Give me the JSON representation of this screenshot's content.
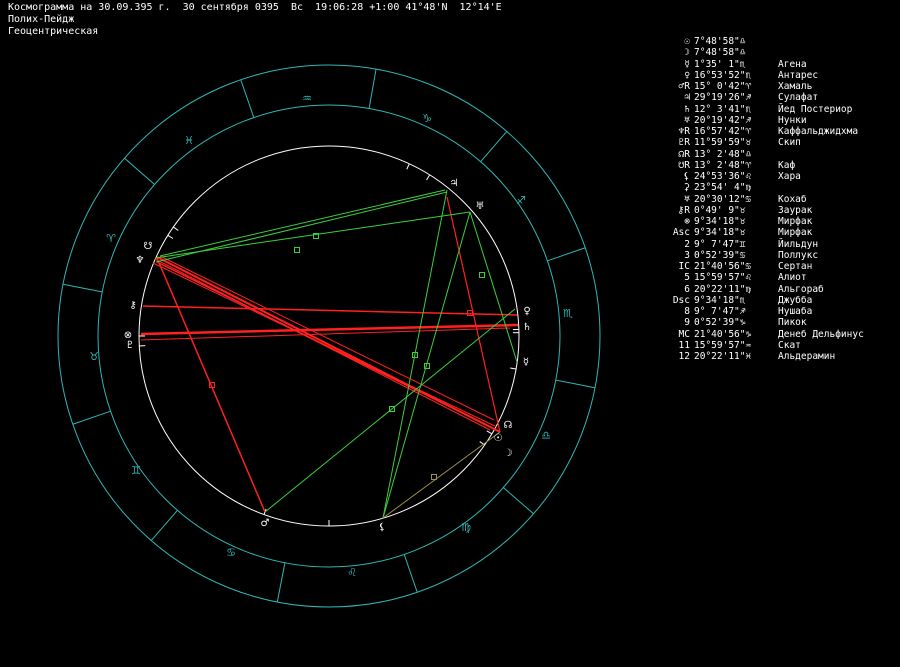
{
  "header": {
    "line1": "Космограмма на 30.09.395 г.  30 сентября 0395  Вс  19:06:28 +1:00 41°48'N  12°14'E",
    "line2": "Полих-Пейдж",
    "line3": "Геоцентрическая"
  },
  "colors": {
    "background": "#000000",
    "ring": "#2fb6b6",
    "wheel_line": "#ffffff",
    "aspect_red": "#ff2020",
    "aspect_green": "#3ccf3c",
    "aspect_olive": "#9a8f4a"
  },
  "zodiac": [
    {
      "name": "Водолей",
      "glyph": "♒"
    },
    {
      "name": "Козерог",
      "glyph": "♑"
    },
    {
      "name": "Стрелец",
      "glyph": "♐"
    },
    {
      "name": "Скорпион",
      "glyph": "♏"
    },
    {
      "name": "Весы",
      "glyph": "♎"
    },
    {
      "name": "Дева",
      "glyph": "♍"
    },
    {
      "name": "Лев",
      "glyph": "♌"
    },
    {
      "name": "Рак",
      "glyph": "♋"
    },
    {
      "name": "Близнецы",
      "glyph": "♊"
    },
    {
      "name": "Телец",
      "glyph": "♉"
    },
    {
      "name": "Овен",
      "glyph": "♈"
    },
    {
      "name": "Рыбы",
      "glyph": "♓"
    }
  ],
  "planets_on_wheel": [
    {
      "glyph": "♃"
    },
    {
      "glyph": "♅"
    },
    {
      "glyph": "☋"
    },
    {
      "glyph": "♆"
    },
    {
      "glyph": "⚷"
    },
    {
      "glyph": "⊗"
    },
    {
      "glyph": "♇"
    },
    {
      "glyph": "♀"
    },
    {
      "glyph": "♄"
    },
    {
      "glyph": "☿"
    },
    {
      "glyph": "☊"
    },
    {
      "glyph": "☉"
    },
    {
      "glyph": "☽"
    },
    {
      "glyph": "⚸"
    },
    {
      "glyph": "♂"
    }
  ],
  "table": [
    {
      "sym": "☉",
      "pos": "7°48'58\"♎",
      "star": ""
    },
    {
      "sym": "☽",
      "pos": "7°48'58\"♎",
      "star": ""
    },
    {
      "sym": "☿",
      "pos": "1°35' 1\"♏",
      "star": "Агена"
    },
    {
      "sym": "♀",
      "pos": "16°53'52\"♏",
      "star": "Антарес"
    },
    {
      "sym": "♂R",
      "pos": "15° 0'42\"♈",
      "star": "Хамаль"
    },
    {
      "sym": "♃",
      "pos": "29°19'26\"♐",
      "star": "Сулафат"
    },
    {
      "sym": "♄",
      "pos": "12° 3'41\"♏",
      "star": "Йед Постериор"
    },
    {
      "sym": "♅",
      "pos": "20°19'42\"♐",
      "star": "Нунки"
    },
    {
      "sym": "♆R",
      "pos": "16°57'42\"♈",
      "star": "Каффальджидхма"
    },
    {
      "sym": "♇R",
      "pos": "11°59'59\"♉",
      "star": "Скип"
    },
    {
      "sym": "☊R",
      "pos": "13° 2'48\"♎",
      "star": ""
    },
    {
      "sym": "☋R",
      "pos": "13° 2'48\"♈",
      "star": "Каф"
    },
    {
      "sym": "⚸",
      "pos": "24°53'36\"♌",
      "star": "Хара"
    },
    {
      "sym": "⚳",
      "pos": "23°54' 4\"♍",
      "star": ""
    },
    {
      "sym": "♅",
      "pos": "20°30'12\"♋",
      "star": "Кохаб"
    },
    {
      "sym": "⚷R",
      "pos": "0°49' 9\"♉",
      "star": "Заурак"
    },
    {
      "sym": "⊗",
      "pos": "9°34'18\"♉",
      "star": "Мирфак"
    },
    {
      "sym": "Asc",
      "pos": "9°34'18\"♉",
      "star": "Мирфак"
    },
    {
      "sym": "2",
      "pos": "9° 7'47\"♊",
      "star": "Йильдун"
    },
    {
      "sym": "3",
      "pos": "0°52'39\"♋",
      "star": "Поллукс"
    },
    {
      "sym": "IC",
      "pos": "21°40'56\"♋",
      "star": "Сертан"
    },
    {
      "sym": "5",
      "pos": "15°59'57\"♌",
      "star": "Алиот"
    },
    {
      "sym": "6",
      "pos": "20°22'11\"♍",
      "star": "Альгораб"
    },
    {
      "sym": "Dsc",
      "pos": "9°34'18\"♏",
      "star": "Джубба"
    },
    {
      "sym": "8",
      "pos": "9° 7'47\"♐",
      "star": "Нушаба"
    },
    {
      "sym": "9",
      "pos": "0°52'39\"♑",
      "star": "Пикок"
    },
    {
      "sym": "MC",
      "pos": "21°40'56\"♑",
      "star": "Денеб Дельфинус"
    },
    {
      "sym": "11",
      "pos": "15°59'57\"♒",
      "star": "Скат"
    },
    {
      "sym": "12",
      "pos": "20°22'11\"♓",
      "star": "Альдерамин"
    }
  ]
}
